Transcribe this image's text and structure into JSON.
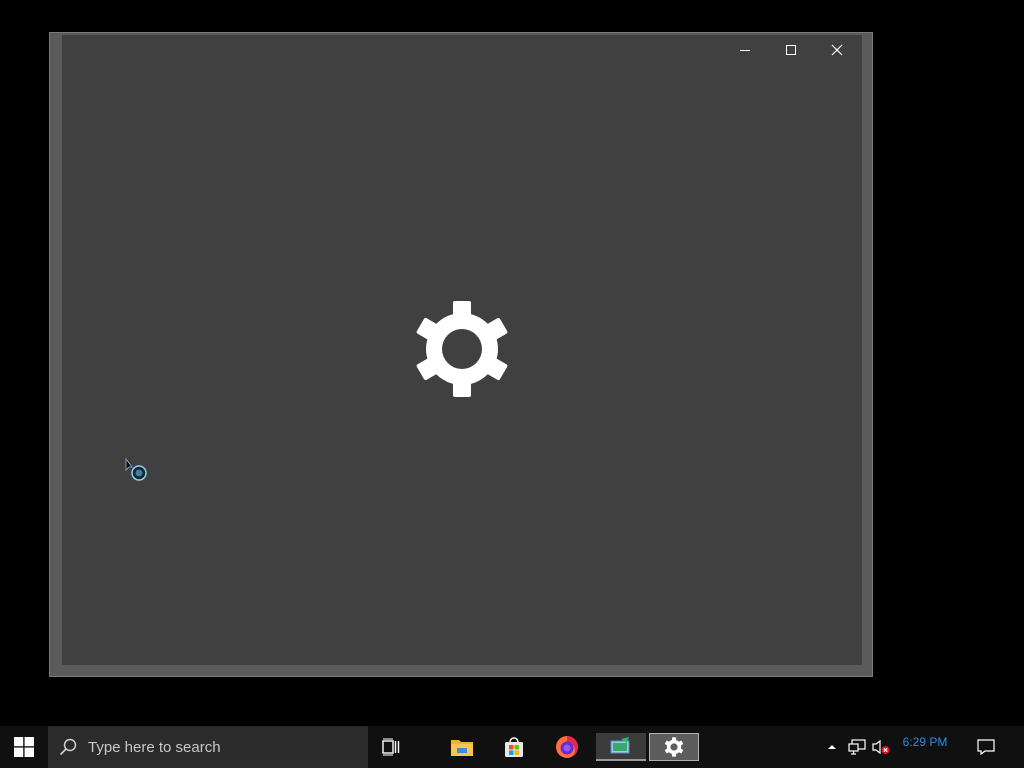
{
  "window": {
    "caption_buttons": [
      "minimize",
      "maximize",
      "close"
    ],
    "splash_icon": "gear-icon"
  },
  "taskbar": {
    "search_placeholder": "Type here to search",
    "pinned": [
      "task-view-icon",
      "file-explorer-icon",
      "microsoft-store-icon",
      "firefox-icon",
      "running-app-icon",
      "settings-icon"
    ],
    "tray": [
      "show-hidden-icons-chevron",
      "network-icon",
      "volume-muted-icon"
    ],
    "clock_time": "6:29 PM",
    "notification_icon": "action-center-icon"
  },
  "colors": {
    "window_bg": "#404040",
    "frame": "#5b5b5b",
    "taskbar_bg": "#101010",
    "clock_text": "#2d8be0"
  }
}
